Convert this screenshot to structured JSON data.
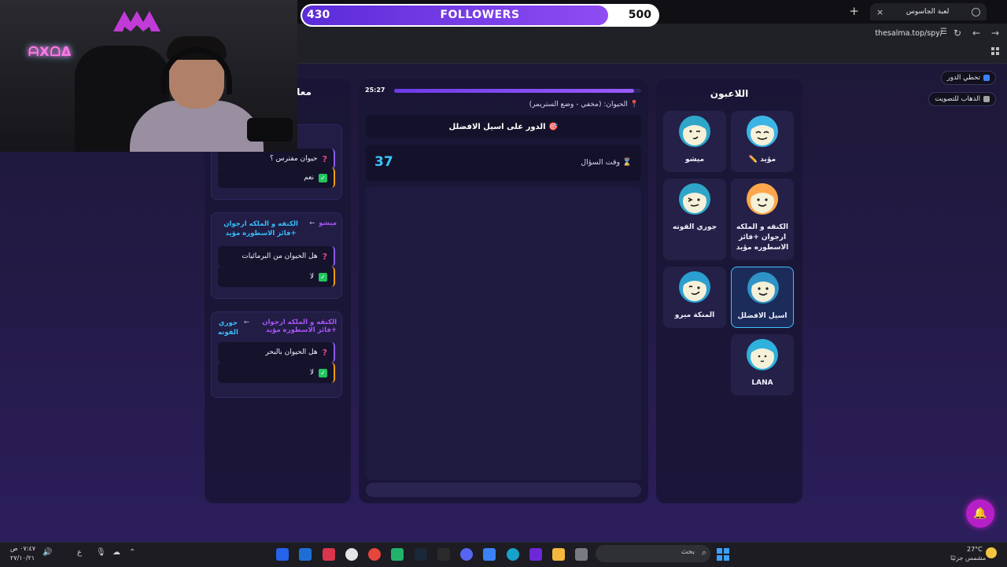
{
  "browser": {
    "tab_title": "لعبة الجاسوس",
    "url": "thesalma.top/spy/",
    "new_tab": "+",
    "close_tab": "×"
  },
  "followers": {
    "current": "430",
    "label": "FOLLOWERS",
    "goal": "500",
    "progress": 0.86
  },
  "webcam": {
    "neon_sign": "ᗩXᗝᐃ"
  },
  "side_buttons": {
    "skip_turn": "تخطي الدور",
    "go_vote": "الذهاب للتصويت"
  },
  "players": {
    "title": "اللاعبون",
    "list": [
      {
        "name": "مؤيد ✏️",
        "color": "#3bb5e6",
        "face": "grin"
      },
      {
        "name": "ميشو",
        "color": "#2fa6c9",
        "face": "wink"
      },
      {
        "name": "الكنقه و الملكه ارجوان +فائز الاسطوره مؤيد",
        "color": "#ffa64d",
        "face": "smile"
      },
      {
        "name": "جوري القوته",
        "color": "#2fa6c9",
        "face": "wink2"
      },
      {
        "name": "اسيل الافضلل",
        "color": "#2f93c7",
        "face": "smile"
      },
      {
        "name": "المنكة ميرو",
        "color": "#2a9fd0",
        "face": "smirk"
      },
      {
        "name": "LANA",
        "color": "#2fb0dd",
        "face": "tiny"
      }
    ]
  },
  "game": {
    "timer": "25:27",
    "timer_progress": 0.97,
    "animal_label": "📍 الحيوان: (مخفي - وضع الستريمر)",
    "turn_label": "🎯 الدور على اسيل الافضلل",
    "question_time_label": "⌛ وقت السؤال",
    "question_time_value": "37"
  },
  "questions": {
    "title": "معا",
    "items": [
      {
        "from": "",
        "to": "",
        "question": "حيوان مفترس ؟",
        "answer": "نعم"
      },
      {
        "from": "ميشو",
        "to": "الكنقه و الملكه ارجوان +فائز الاسطوره مؤيد",
        "question": "هل الحيوان من البرمائيات",
        "answer": "لا"
      },
      {
        "from": "الكنقه و الملكه ارجوان +فائز الاسطوره مؤيد",
        "to": "جوري القوته",
        "question": "هل الحيوان بالبحر",
        "answer": "لا"
      }
    ],
    "arrow": "←"
  },
  "taskbar": {
    "search_placeholder": "بحث",
    "weather_temp": "27°C",
    "weather_desc": "مشمس جزئيًا",
    "time": "٠٧:٤٧ ص",
    "date": "٢٧/١٠/٢١",
    "lang": "ع"
  },
  "colors": {
    "accent_purple": "#7c3aed",
    "accent_cyan": "#38bdf8",
    "active_border": "#3fc2ff"
  }
}
